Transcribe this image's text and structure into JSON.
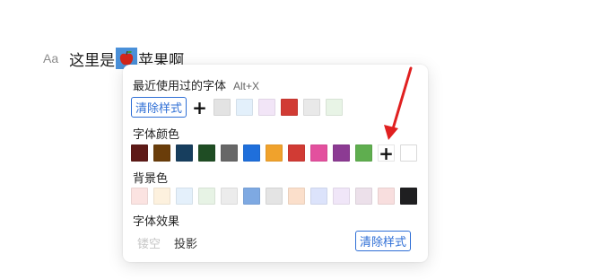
{
  "doc": {
    "aa_label": "Aa",
    "text_before": "这里是",
    "text_after": "苹果啊"
  },
  "panel": {
    "recent_title": "最近使用过的字体",
    "recent_hotkey": "Alt+X",
    "clear_label": "清除样式",
    "recent_swatches": [
      "#e3e3e3",
      "#e3f0fb",
      "#f2e5f7",
      "#d13b34",
      "#e9e9e9",
      "#e8f4e6"
    ],
    "font_color_title": "字体颜色",
    "font_colors": [
      "#5e1a17",
      "#6a3d0a",
      "#173e5e",
      "#1f4d24",
      "#676767",
      "#1f6fdb",
      "#f0a22c",
      "#d13b34",
      "#e3509e",
      "#8c3b93",
      "#5fae4f"
    ],
    "font_color_extra": "#ffffff",
    "bg_title": "背景色",
    "bg_colors": [
      "#fbe3e1",
      "#fdf1de",
      "#e4f0fb",
      "#e7f3e5",
      "#ececec",
      "#7ea9e2",
      "#e4e4e4",
      "#fbdfcb",
      "#dce3fb",
      "#f0e6f8",
      "#ece0ea",
      "#f8dede",
      "#1f1f21"
    ],
    "effects_title": "字体效果",
    "effect_hollow": "镂空",
    "effect_shadow": "投影",
    "clear_label_2": "清除样式"
  },
  "accent_color": "#2f6fd6",
  "arrow_color": "#e02020"
}
